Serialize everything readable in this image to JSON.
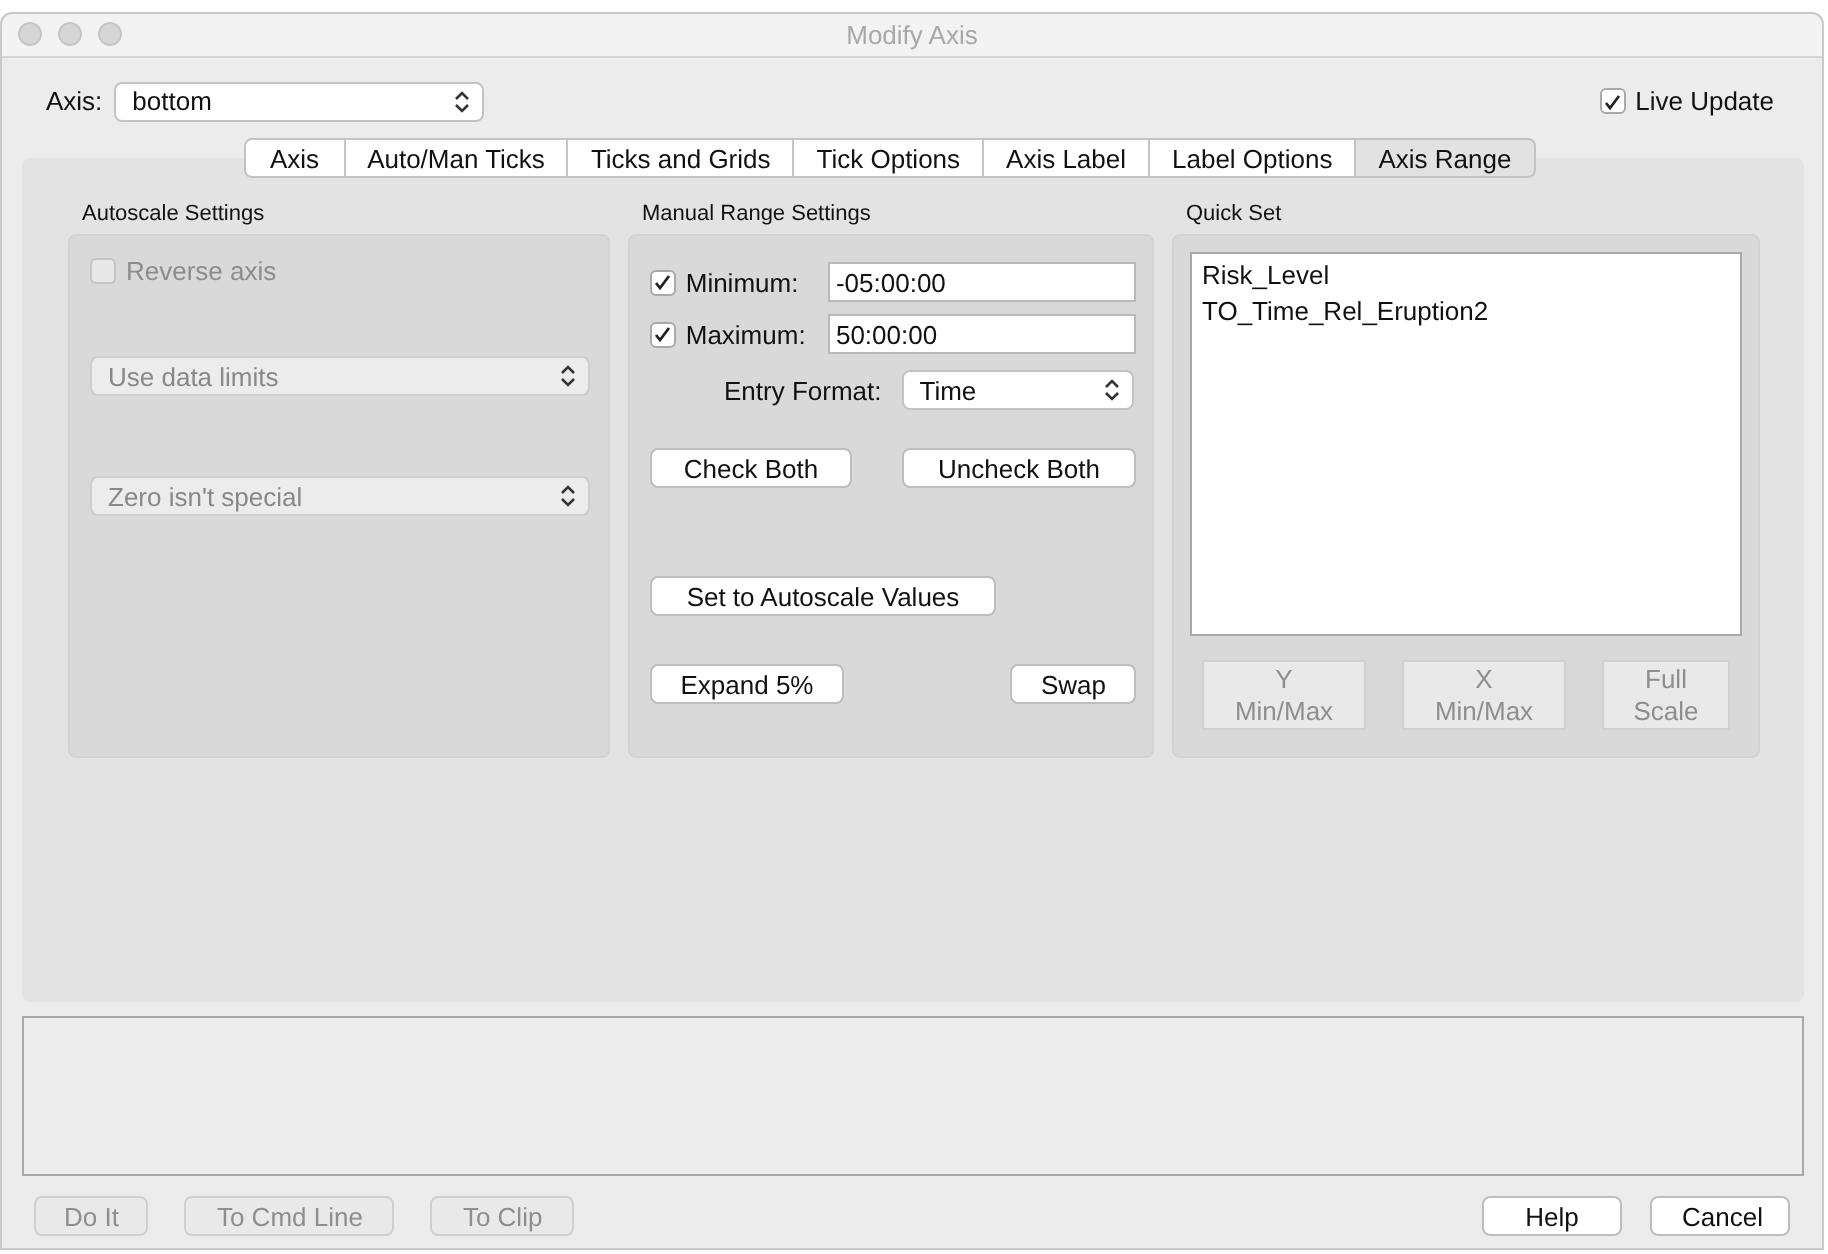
{
  "window": {
    "title": "Modify Axis"
  },
  "axis": {
    "label": "Axis:",
    "value": "bottom"
  },
  "live_update": {
    "label": "Live Update",
    "checked": true
  },
  "tabs": [
    {
      "label": "Axis",
      "selected": false
    },
    {
      "label": "Auto/Man Ticks",
      "selected": false
    },
    {
      "label": "Ticks and Grids",
      "selected": false
    },
    {
      "label": "Tick Options",
      "selected": false
    },
    {
      "label": "Axis Label",
      "selected": false
    },
    {
      "label": "Label Options",
      "selected": false
    },
    {
      "label": "Axis Range",
      "selected": true
    }
  ],
  "autoscale": {
    "title": "Autoscale Settings",
    "reverse_axis": {
      "label": "Reverse axis",
      "checked": false,
      "disabled": true
    },
    "selects": [
      {
        "value": "Use data limits",
        "disabled": true
      },
      {
        "value": "Zero isn't special",
        "disabled": true
      }
    ]
  },
  "manual_range": {
    "title": "Manual Range Settings",
    "fields": [
      {
        "label": "Minimum:",
        "checked": true,
        "value": "-05:00:00"
      },
      {
        "label": "Maximum:",
        "checked": true,
        "value": "50:00:00"
      }
    ],
    "entry_format": {
      "label": "Entry Format:",
      "value": "Time"
    },
    "button_rows": [
      [
        {
          "label": "Check Both"
        },
        {
          "label": "Uncheck Both"
        }
      ],
      [
        {
          "label": "Set to Autoscale Values"
        }
      ],
      [
        {
          "label": "Expand 5%"
        },
        {
          "label": "Swap"
        }
      ]
    ]
  },
  "quick_set": {
    "title": "Quick Set",
    "items": [
      {
        "label": "Risk_Level",
        "selected": false
      },
      {
        "label": "TO_Time_Rel_Eruption2",
        "selected": false
      }
    ],
    "buttons": [
      {
        "label": "Y\nMin/Max",
        "disabled": true
      },
      {
        "label": "X\nMin/Max",
        "disabled": true
      },
      {
        "label": "Full\nScale",
        "disabled": true
      }
    ]
  },
  "footer": {
    "left": [
      {
        "label": "Do It",
        "disabled": true
      },
      {
        "label": "To Cmd Line",
        "disabled": true
      },
      {
        "label": "To Clip",
        "disabled": true
      }
    ],
    "right": [
      {
        "label": "Help",
        "disabled": false
      },
      {
        "label": "Cancel",
        "disabled": false
      }
    ]
  }
}
